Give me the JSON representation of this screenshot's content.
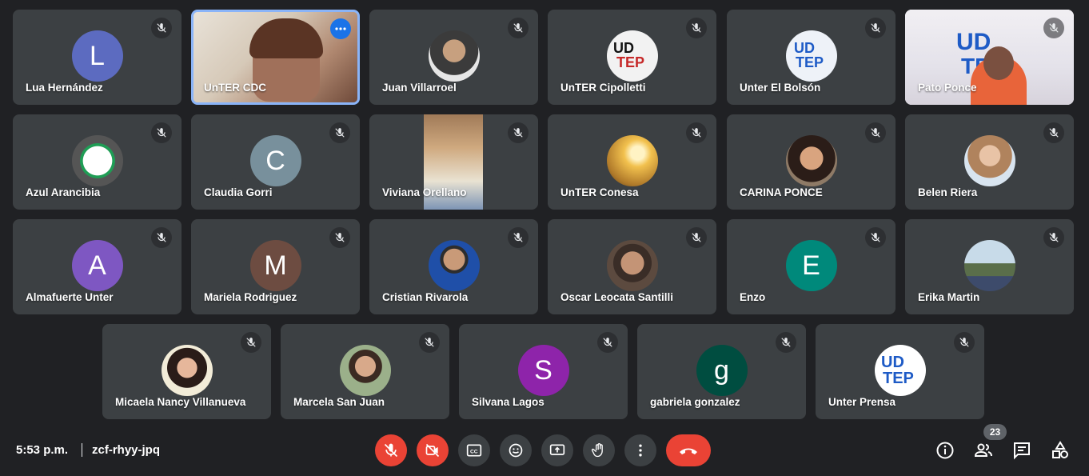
{
  "participants": [
    {
      "name": "Lua Hernández",
      "initial": "L",
      "color": "#5c6bc0",
      "kind": "initial"
    },
    {
      "name": "UnTER CDC",
      "kind": "video"
    },
    {
      "name": "Juan Villarroel",
      "kind": "photo",
      "color": "#7a6e63"
    },
    {
      "name": "UnTER Cipolletti",
      "kind": "photo",
      "color": "#d8d8d8"
    },
    {
      "name": "Unter El Bolsón",
      "kind": "photo",
      "color": "#e0e6ef"
    },
    {
      "name": "Pato Ponce",
      "kind": "video"
    },
    {
      "name": "Azul Arancibia",
      "kind": "photo",
      "color": "#4a4f55"
    },
    {
      "name": "Claudia Gorri",
      "initial": "C",
      "color": "#78909c",
      "kind": "initial"
    },
    {
      "name": "Viviana Orellano",
      "kind": "video"
    },
    {
      "name": "UnTER Conesa",
      "kind": "photo",
      "color": "#e7b54a"
    },
    {
      "name": "CARINA PONCE",
      "kind": "photo",
      "color": "#8d5a44"
    },
    {
      "name": "Belen Riera",
      "kind": "photo",
      "color": "#b59a86"
    },
    {
      "name": "Almafuerte Unter",
      "initial": "A",
      "color": "#7e57c2",
      "kind": "initial"
    },
    {
      "name": "Mariela Rodriguez",
      "initial": "M",
      "color": "#6d4c41",
      "kind": "initial"
    },
    {
      "name": "Cristian Rivarola",
      "kind": "photo",
      "color": "#6b7f9b"
    },
    {
      "name": "Oscar Leocata Santilli",
      "kind": "photo",
      "color": "#5c4a3f"
    },
    {
      "name": "Enzo",
      "initial": "E",
      "color": "#00897b",
      "kind": "initial"
    },
    {
      "name": "Erika Martin",
      "kind": "photo",
      "color": "#7f9b7a"
    },
    {
      "name": "Micaela Nancy Villanueva",
      "kind": "photo",
      "color": "#c6a98c"
    },
    {
      "name": "Marcela San Juan",
      "kind": "photo",
      "color": "#8a9a7a"
    },
    {
      "name": "Silvana Lagos",
      "initial": "S",
      "color": "#8e24aa",
      "kind": "initial"
    },
    {
      "name": "gabriela gonzalez",
      "initial": "g",
      "color": "#004d40",
      "kind": "initial"
    },
    {
      "name": "Unter Prensa",
      "kind": "photo",
      "color": "#ffffff"
    }
  ],
  "bottom_bar": {
    "time": "5:53 p.m.",
    "meeting_code": "zcf-rhyy-jpq",
    "participant_count": "23",
    "controls": [
      "mic-off",
      "camera-off",
      "captions",
      "reactions",
      "present",
      "raise-hand",
      "more-options",
      "leave-call"
    ],
    "right_icons": [
      "info",
      "people",
      "chat",
      "activities"
    ]
  },
  "colors": {
    "background": "#202124",
    "tile": "#3c4043",
    "danger": "#ea4335",
    "active_border": "#8ab4f8"
  }
}
